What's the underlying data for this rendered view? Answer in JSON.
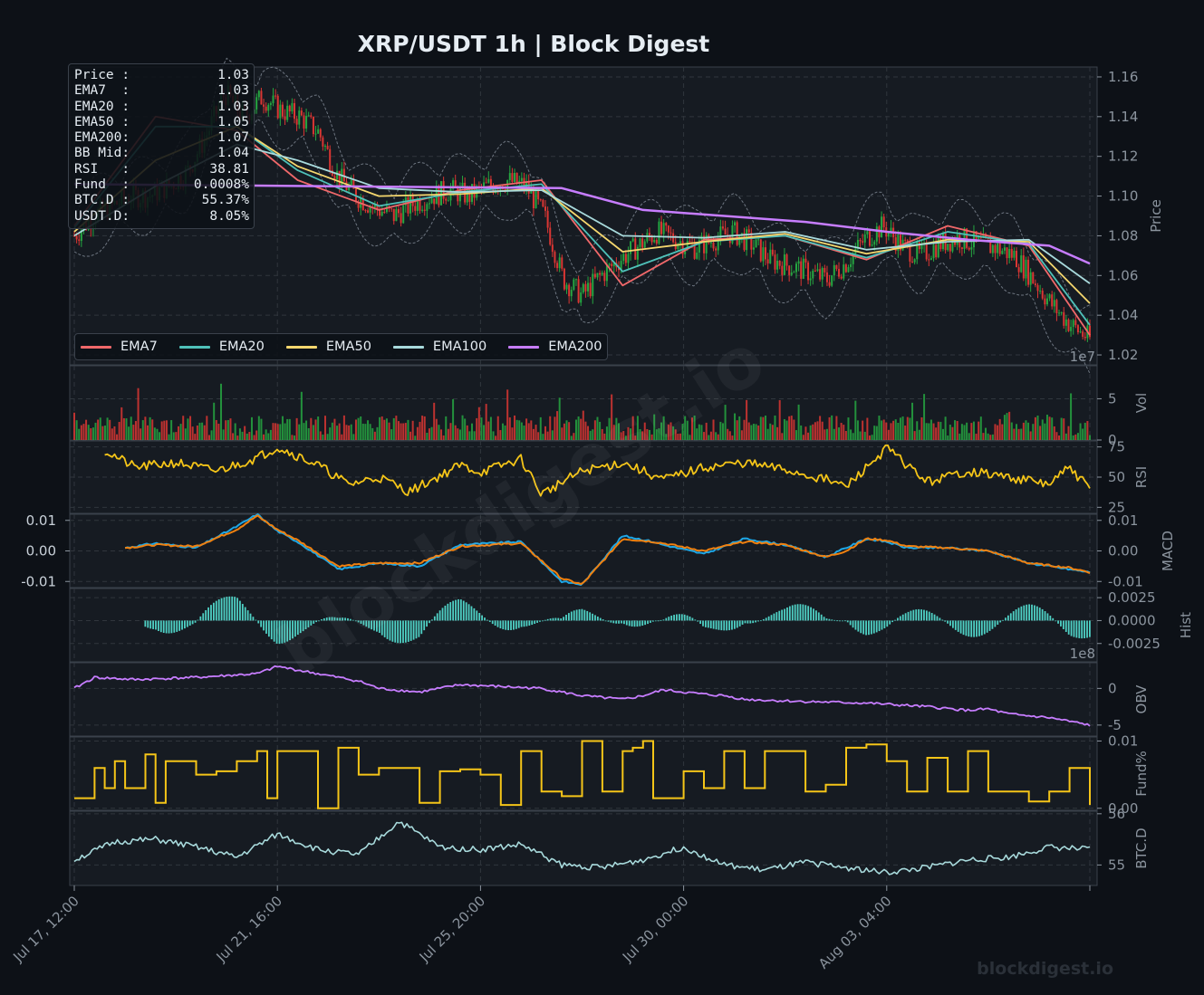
{
  "title": "XRP/USDT  1h  |  Block Digest",
  "watermark": "blockdigest.io",
  "footer_brand": "blockdigest.io",
  "colors": {
    "background": "#0d1117",
    "panel": "#161b22",
    "grid": "#30363d",
    "up": "#26a641",
    "down": "#da3633",
    "ema7": "#f0686a",
    "ema20": "#4fc1b9",
    "ema50": "#f5d76e",
    "ema100": "#a8dadc",
    "ema200": "#c77dff",
    "rsi": "#f5c518",
    "macd": "#1ea7e6",
    "signal": "#f0800f",
    "hist": "#4fd1c5",
    "obv": "#c77dff",
    "funding": "#f5c518",
    "btcd": "#a8dadc"
  },
  "info_box": [
    {
      "label": "Price :",
      "value": "1.03"
    },
    {
      "label": "EMA7  :",
      "value": "1.03"
    },
    {
      "label": "EMA20 :",
      "value": "1.03"
    },
    {
      "label": "EMA50 :",
      "value": "1.05"
    },
    {
      "label": "EMA200:",
      "value": "1.07"
    },
    {
      "label": "BB Mid:",
      "value": "1.04"
    },
    {
      "label": "RSI   :",
      "value": "38.81"
    },
    {
      "label": "Fund  :",
      "value": "0.0008%"
    },
    {
      "label": "BTC.D :",
      "value": "55.37%"
    },
    {
      "label": "USDT.D:",
      "value": "8.05%"
    }
  ],
  "legend": [
    {
      "name": "EMA7",
      "color": "#f0686a"
    },
    {
      "name": "EMA20",
      "color": "#4fc1b9"
    },
    {
      "name": "EMA50",
      "color": "#f5d76e"
    },
    {
      "name": "EMA100",
      "color": "#a8dadc"
    },
    {
      "name": "EMA200",
      "color": "#c77dff"
    }
  ],
  "chart_data": {
    "type": "line",
    "title": "XRP/USDT  1h  |  Block Digest",
    "xlabel": "",
    "x_ticks": [
      "Jul 17, 12:00",
      "Jul 21, 16:00",
      "Jul 25, 20:00",
      "Jul 30, 00:00",
      "Aug 03, 04:00"
    ],
    "grid": true,
    "legend_position": "bottom-left",
    "panels": [
      {
        "id": "price",
        "ylabel": "Price",
        "ylim": [
          1.015,
          1.165
        ],
        "yticks": [
          "1.02",
          "1.04",
          "1.06",
          "1.08",
          "1.10",
          "1.12",
          "1.14",
          "1.16"
        ],
        "yticks_values": [
          1.02,
          1.04,
          1.06,
          1.08,
          1.1,
          1.12,
          1.14,
          1.16
        ],
        "series": [
          {
            "name": "EMA7",
            "x": [
              0,
              8,
              16,
              22,
              30,
              38,
              46,
              54,
              62,
              70,
              78,
              86,
              94,
              100
            ],
            "values": [
              1.085,
              1.14,
              1.133,
              1.108,
              1.093,
              1.103,
              1.108,
              1.055,
              1.078,
              1.08,
              1.068,
              1.085,
              1.075,
              1.03
            ]
          },
          {
            "name": "EMA20",
            "x": [
              0,
              8,
              16,
              22,
              30,
              38,
              46,
              54,
              62,
              70,
              78,
              86,
              94,
              100
            ],
            "values": [
              1.084,
              1.135,
              1.135,
              1.113,
              1.095,
              1.102,
              1.106,
              1.062,
              1.077,
              1.08,
              1.069,
              1.082,
              1.076,
              1.035
            ]
          },
          {
            "name": "EMA50",
            "x": [
              0,
              8,
              16,
              22,
              30,
              38,
              46,
              54,
              62,
              70,
              78,
              86,
              94,
              100
            ],
            "values": [
              1.082,
              1.118,
              1.135,
              1.115,
              1.1,
              1.101,
              1.104,
              1.072,
              1.077,
              1.081,
              1.071,
              1.078,
              1.077,
              1.046
            ]
          },
          {
            "name": "EMA100",
            "x": [
              0,
              8,
              16,
              22,
              30,
              38,
              46,
              54,
              62,
              70,
              78,
              86,
              94,
              100
            ],
            "values": [
              1.08,
              1.105,
              1.126,
              1.118,
              1.104,
              1.102,
              1.103,
              1.08,
              1.079,
              1.082,
              1.073,
              1.077,
              1.078,
              1.056
            ]
          },
          {
            "name": "EMA200",
            "x": [
              0,
              48,
              56,
              64,
              72,
              80,
              88,
              96,
              100
            ],
            "values": [
              1.106,
              1.104,
              1.093,
              1.09,
              1.087,
              1.082,
              1.078,
              1.075,
              1.066
            ]
          }
        ],
        "closes": [
          1.08,
          1.09,
          1.095,
          1.1,
          1.1,
          1.105,
          1.112,
          1.13,
          1.152,
          1.14,
          1.15,
          1.143,
          1.14,
          1.132,
          1.11,
          1.1,
          1.094,
          1.09,
          1.096,
          1.1,
          1.103,
          1.1,
          1.105,
          1.108,
          1.105,
          1.09,
          1.058,
          1.05,
          1.06,
          1.068,
          1.075,
          1.082,
          1.078,
          1.074,
          1.078,
          1.082,
          1.076,
          1.068,
          1.065,
          1.062,
          1.058,
          1.066,
          1.078,
          1.085,
          1.075,
          1.07,
          1.076,
          1.079,
          1.076,
          1.074,
          1.07,
          1.058,
          1.045,
          1.035,
          1.028
        ]
      },
      {
        "id": "volume",
        "ylabel": "Vol",
        "exponent": "1e7",
        "ylim": [
          0,
          9
        ],
        "yticks": [
          "0",
          "5"
        ],
        "yticks_values": [
          0,
          5
        ]
      },
      {
        "id": "rsi",
        "ylabel": "RSI",
        "ylim": [
          20,
          80
        ],
        "yticks": [
          "25",
          "50",
          "75"
        ],
        "yticks_values": [
          25,
          50,
          75
        ],
        "series": [
          {
            "name": "RSI",
            "x": [
              3,
              6,
              10,
              14,
              18,
              20,
              24,
              27,
              30,
              33,
              38,
              40,
              44,
              46,
              50,
              54,
              58,
              62,
              66,
              70,
              74,
              76,
              80,
              84,
              88,
              92,
              96,
              98,
              100
            ],
            "values": [
              72,
              58,
              62,
              55,
              66,
              75,
              60,
              44,
              50,
              38,
              60,
              54,
              65,
              36,
              55,
              62,
              48,
              58,
              62,
              56,
              48,
              42,
              74,
              46,
              55,
              50,
              44,
              58,
              40
            ]
          }
        ]
      },
      {
        "id": "macd",
        "ylabel": "MACD",
        "ylim": [
          -0.012,
          0.012
        ],
        "yticks": [
          "0.01",
          "0.00",
          "-0.01"
        ],
        "yticks_values": [
          0.01,
          0.0,
          -0.01
        ],
        "yticks_left": [
          "0.01",
          "0.00",
          "-0.01"
        ],
        "series": [
          {
            "name": "MACD",
            "x": [
              5,
              8,
              12,
              16,
              18,
              20,
              22,
              26,
              30,
              34,
              38,
              44,
              48,
              50,
              54,
              57,
              58,
              62,
              66,
              70,
              74,
              76,
              78,
              80,
              82,
              86,
              90,
              94,
              98,
              100
            ],
            "values": [
              0.001,
              0.0025,
              0.001,
              0.008,
              0.012,
              0.0065,
              0.003,
              -0.006,
              -0.004,
              -0.005,
              0.002,
              0.003,
              -0.01,
              -0.011,
              0.005,
              0.003,
              0.002,
              -0.001,
              0.004,
              0.002,
              -0.002,
              0.001,
              0.004,
              0.003,
              0.001,
              0.001,
              0.0,
              -0.004,
              -0.006,
              -0.007
            ]
          },
          {
            "name": "Signal",
            "x": [
              5,
              8,
              12,
              16,
              18,
              20,
              22,
              26,
              30,
              34,
              38,
              44,
              48,
              50,
              54,
              57,
              58,
              62,
              66,
              70,
              74,
              76,
              78,
              80,
              82,
              86,
              90,
              94,
              98,
              100
            ],
            "values": [
              0.001,
              0.002,
              0.0015,
              0.007,
              0.0115,
              0.007,
              0.0035,
              -0.005,
              -0.004,
              -0.004,
              0.0015,
              0.0025,
              -0.009,
              -0.011,
              0.004,
              0.003,
              0.0025,
              0.0,
              0.003,
              0.002,
              -0.002,
              0.0,
              0.004,
              0.0035,
              0.0015,
              0.001,
              0.0,
              -0.004,
              -0.0055,
              -0.007
            ]
          }
        ]
      },
      {
        "id": "hist",
        "ylabel": "Hist",
        "ylim": [
          -0.0045,
          0.0035
        ],
        "yticks": [
          "0.0025",
          "0.0000",
          "-0.0025"
        ],
        "yticks_values": [
          0.0025,
          0.0,
          -0.0025
        ]
      },
      {
        "id": "obv",
        "ylabel": "OBV",
        "exponent": "1e8",
        "ylim": [
          -6.5,
          3.5
        ],
        "yticks": [
          "0",
          "-5"
        ],
        "yticks_values": [
          0,
          -5
        ],
        "series": [
          {
            "name": "OBV",
            "x": [
              0,
              2,
              6,
              12,
              18,
              20,
              24,
              28,
              30,
              34,
              38,
              46,
              50,
              54,
              56,
              58,
              62,
              64,
              66,
              72,
              78,
              84,
              88,
              90,
              92,
              96,
              98,
              100
            ],
            "values": [
              0,
              1.5,
              1.2,
              1.5,
              2,
              3,
              2,
              1,
              0,
              -0.5,
              0.5,
              0,
              -1,
              -1.5,
              -1,
              -0.2,
              -0.8,
              -1,
              -1.5,
              -1.8,
              -2,
              -2.5,
              -3,
              -2.8,
              -3.5,
              -4,
              -4.5,
              -5
            ]
          }
        ]
      },
      {
        "id": "funding",
        "ylabel": "Fund%",
        "ylim": [
          -0.0003,
          0.0106
        ],
        "yticks": [
          "0.01",
          "0.00"
        ],
        "yticks_values": [
          0.01,
          0.0
        ],
        "series": [
          {
            "name": "Funding",
            "x": [
              0,
              1,
              2,
              3,
              4,
              5,
              7,
              8,
              9,
              12,
              14,
              16,
              18,
              19,
              20,
              24,
              26,
              28,
              30,
              32,
              34,
              36,
              38,
              40,
              42,
              44,
              46,
              48,
              50,
              52,
              54,
              55,
              56,
              57,
              60,
              62,
              64,
              66,
              68,
              70,
              72,
              74,
              76,
              78,
              80,
              82,
              84,
              86,
              88,
              90,
              92,
              94,
              96,
              98,
              100
            ],
            "values": [
              0.0015,
              0.0015,
              0.006,
              0.003,
              0.007,
              0.003,
              0.008,
              0.0008,
              0.007,
              0.005,
              0.0055,
              0.007,
              0.0085,
              0.0015,
              0.0085,
              0.0,
              0.009,
              0.005,
              0.006,
              0.006,
              0.0008,
              0.0055,
              0.0058,
              0.005,
              0.0005,
              0.0085,
              0.0025,
              0.0018,
              0.01,
              0.0025,
              0.0085,
              0.009,
              0.01,
              0.0015,
              0.0055,
              0.003,
              0.0085,
              0.003,
              0.0085,
              0.0085,
              0.0025,
              0.0035,
              0.009,
              0.0095,
              0.007,
              0.0025,
              0.0075,
              0.0025,
              0.0085,
              0.0025,
              0.0025,
              0.001,
              0.0025,
              0.006,
              0.0005
            ]
          }
        ]
      },
      {
        "id": "btcd",
        "ylabel": "BTC.D",
        "ylim": [
          54.6,
          56.05
        ],
        "yticks": [
          "56",
          "55"
        ],
        "yticks_values": [
          56,
          55
        ],
        "series": [
          {
            "name": "BTC.D",
            "x": [
              0,
              4,
              8,
              12,
              16,
              20,
              24,
              28,
              32,
              36,
              40,
              44,
              48,
              52,
              56,
              60,
              64,
              68,
              72,
              76,
              80,
              84,
              88,
              92,
              96,
              100
            ],
            "values": [
              55.1,
              55.45,
              55.5,
              55.35,
              55.15,
              55.6,
              55.3,
              55.2,
              55.85,
              55.35,
              55.3,
              55.4,
              55.0,
              54.95,
              55.1,
              55.35,
              55.0,
              54.9,
              55.05,
              54.95,
              54.85,
              54.95,
              55.1,
              55.15,
              55.35,
              55.3
            ]
          }
        ]
      }
    ]
  }
}
